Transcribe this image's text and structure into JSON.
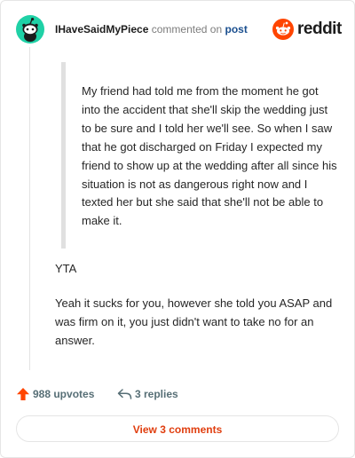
{
  "header": {
    "username": "IHaveSaidMyPiece",
    "verb": "commented on",
    "post_link": "post",
    "brand": "reddit"
  },
  "comment": {
    "quote": "My friend had told me from the moment he got into the accident that she'll skip the wedding just to be sure and I told her we'll see. So when I saw that he got discharged on Friday I expected my friend to show up at the wedding after all since his situation is not as dangerous right now and I texted her but she said that she'll not be able to make it.",
    "verdict": "YTA",
    "reply": "Yeah it sucks for you, however she told you ASAP and was firm on it, you just didn't want to take no for an answer."
  },
  "actions": {
    "upvotes": "988 upvotes",
    "replies": "3 replies"
  },
  "footer": {
    "view_comments": "View 3 comments"
  },
  "colors": {
    "avatar_bg": "#1fd1a6",
    "brand_orange": "#ff4500",
    "upvote": "#ff4500",
    "link": "#1a4f8f",
    "button_text": "#e03e0f"
  },
  "icons": {
    "avatar": "snoo-avatar-icon",
    "brand": "reddit-logo-icon",
    "upvote": "upvote-arrow-icon",
    "reply": "reply-arrow-icon"
  }
}
